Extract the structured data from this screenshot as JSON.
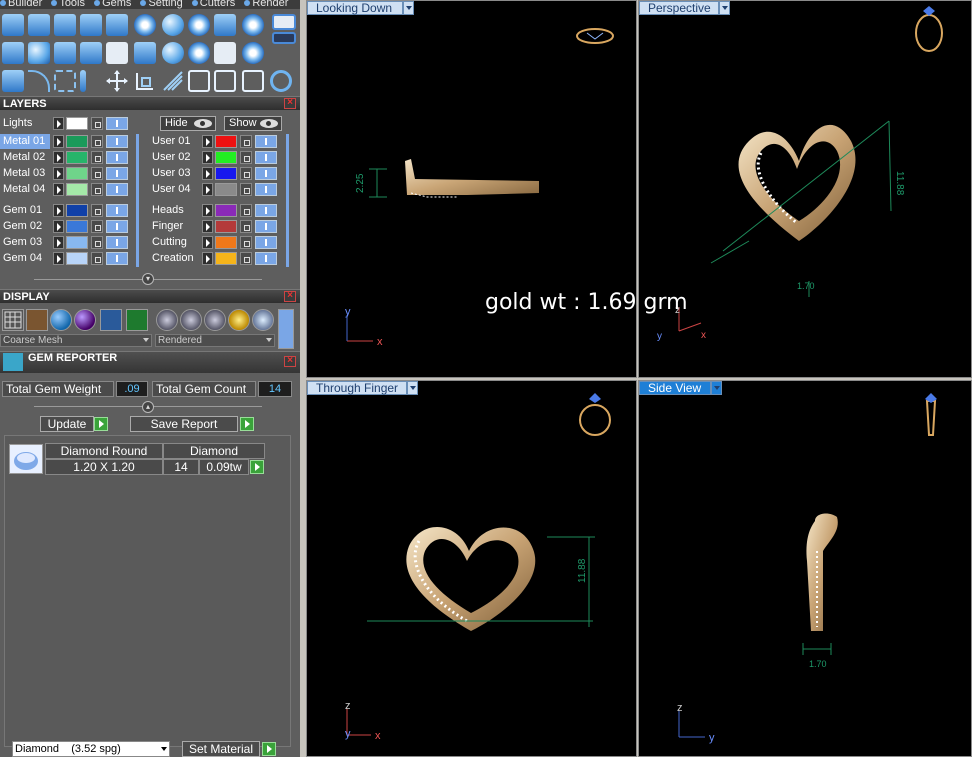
{
  "menu": {
    "items": [
      "Builder",
      "Tools",
      "Gems",
      "Setting",
      "Cutters",
      "Render"
    ]
  },
  "layers": {
    "title": "LAYERS",
    "lights_label": "Lights",
    "hide_label": "Hide",
    "show_label": "Show",
    "left": [
      {
        "name": "Metal 01",
        "color": "#1a9a5a",
        "selected": true
      },
      {
        "name": "Metal 02",
        "color": "#27b46a",
        "selected": false
      },
      {
        "name": "Metal 03",
        "color": "#6fd48a",
        "selected": false
      },
      {
        "name": "Metal 04",
        "color": "#a4e8a8",
        "selected": false
      },
      {
        "name": "Gem 01",
        "color": "#1040a8",
        "selected": false
      },
      {
        "name": "Gem 02",
        "color": "#3a78d8",
        "selected": false
      },
      {
        "name": "Gem 03",
        "color": "#88b8f0",
        "selected": false
      },
      {
        "name": "Gem 04",
        "color": "#b8d4f8",
        "selected": false
      }
    ],
    "right": [
      {
        "name": "User 01",
        "color": "#ee1111"
      },
      {
        "name": "User 02",
        "color": "#22ee22"
      },
      {
        "name": "User 03",
        "color": "#1818ee"
      },
      {
        "name": "User 04",
        "color": "#8a8a8a"
      },
      {
        "name": "Heads",
        "color": "#8a2ab8"
      },
      {
        "name": "Finger",
        "color": "#b43a3a"
      },
      {
        "name": "Cutting",
        "color": "#f0781a"
      },
      {
        "name": "Creation",
        "color": "#f5b41a"
      }
    ]
  },
  "display": {
    "title": "DISPLAY",
    "mesh_mode": "Coarse Mesh",
    "render_mode": "Rendered"
  },
  "gem_reporter": {
    "title": "GEM REPORTER",
    "total_weight_label": "Total Gem Weight",
    "total_weight_value": ".09",
    "total_count_label": "Total Gem Count",
    "total_count_value": "14",
    "update_label": "Update",
    "save_report_label": "Save Report",
    "rows": [
      {
        "shape": "Diamond Round",
        "size": "1.20 X 1.20",
        "material": "Diamond",
        "count": "14",
        "weight": "0.09tw"
      }
    ]
  },
  "material": {
    "selected": "Diamond    (3.52 spg)",
    "set_label": "Set Material"
  },
  "viewports": {
    "top_left": {
      "label": "Looking Down",
      "dim": "2.25"
    },
    "top_right": {
      "label": "Perspective",
      "dim_height": "11.88",
      "dim_width": "1.70"
    },
    "bottom_left": {
      "label": "Through Finger",
      "dim": "11.88"
    },
    "bottom_right": {
      "label": "Side View",
      "dim": "1.70"
    },
    "active": "bottom_right"
  },
  "overlay": {
    "gold_weight": "gold wt :  1.69 grm"
  },
  "axes": {
    "x": "x",
    "y": "y",
    "z": "z"
  }
}
